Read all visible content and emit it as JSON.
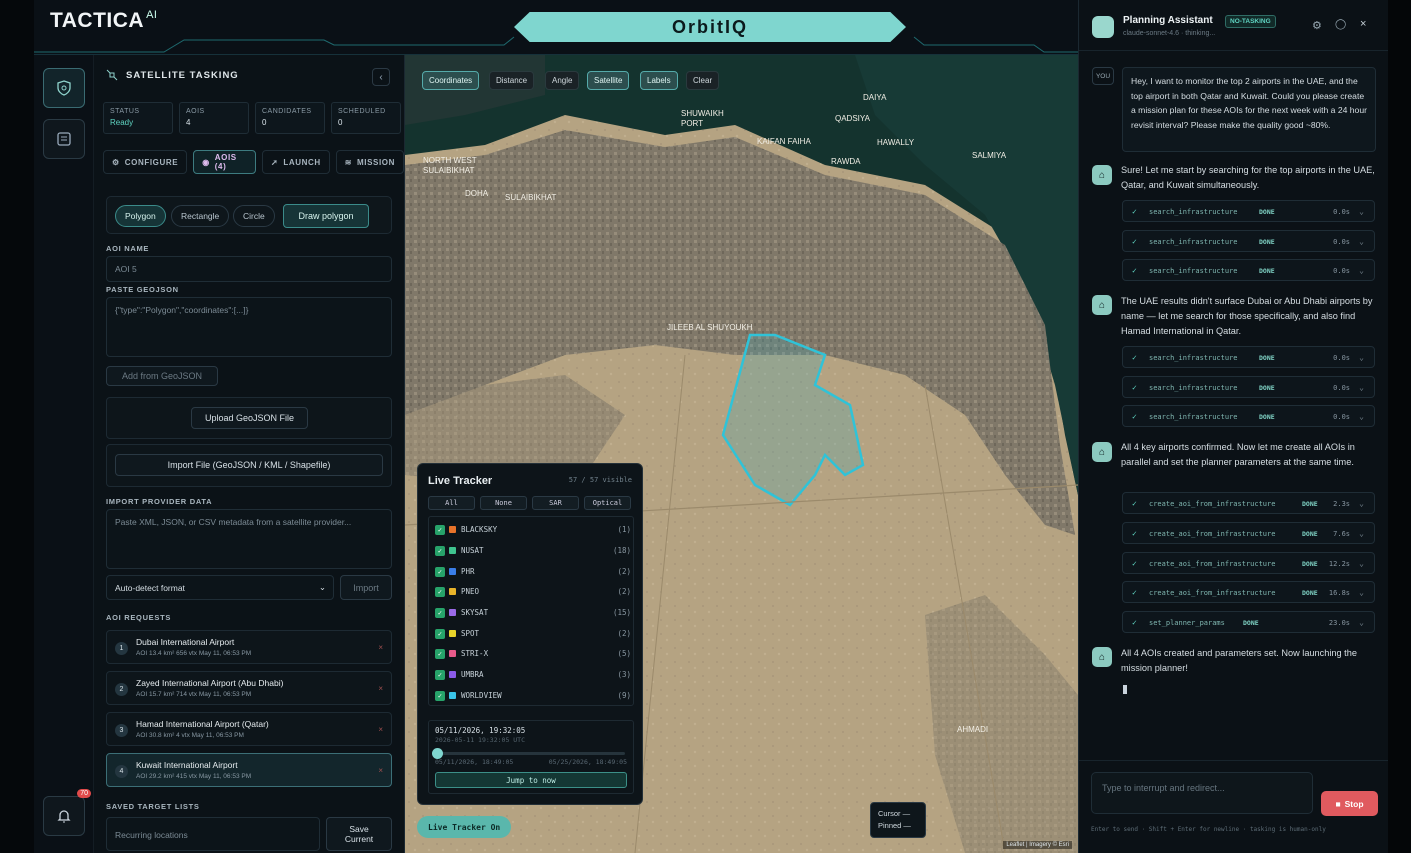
{
  "brand": {
    "name": "TACTICA",
    "suffix": "AI"
  },
  "center_title": "OrbitIQ",
  "panel": {
    "title": "SATELLITE TASKING",
    "stats": [
      {
        "k": "STATUS",
        "v": "Ready"
      },
      {
        "k": "AOIS",
        "v": "4"
      },
      {
        "k": "CANDIDATES",
        "v": "0"
      },
      {
        "k": "SCHEDULED",
        "v": "0"
      }
    ],
    "tabs": [
      "CONFIGURE",
      "AOIS (4)",
      "LAUNCH",
      "MISSION"
    ],
    "shapes": [
      "Polygon",
      "Rectangle",
      "Circle"
    ],
    "draw_polygon": "Draw polygon",
    "aoi_name_label": "AOI NAME",
    "aoi_name_value": "AOI 5",
    "geojson_label": "PASTE GEOJSON",
    "geojson_placeholder": "{\"type\":\"Polygon\",\"coordinates\":[...]}",
    "add_geojson": "Add from GeoJSON",
    "upload": "Upload GeoJSON File",
    "import_file": "Import File (GeoJSON / KML / Shapefile)",
    "provider_label": "IMPORT PROVIDER DATA",
    "provider_placeholder": "Paste XML, JSON, or CSV metadata from a satellite provider...",
    "format_select": "Auto-detect format",
    "import_btn": "Import",
    "requests_label": "AOI REQUESTS",
    "aois": [
      {
        "n": "1",
        "name": "Dubai International Airport",
        "meta": "AOI   13.4 km²    656 vtx    May 11, 06:53 PM"
      },
      {
        "n": "2",
        "name": "Zayed International Airport (Abu Dhabi)",
        "meta": "AOI   15.7 km²    714 vtx    May 11, 06:53 PM"
      },
      {
        "n": "3",
        "name": "Hamad International Airport (Qatar)",
        "meta": "AOI   30.8 km²    4 vtx    May 11, 06:53 PM"
      },
      {
        "n": "4",
        "name": "Kuwait International Airport",
        "meta": "AOI   29.2 km²    415 vtx    May 11, 06:53 PM"
      }
    ],
    "saved_label": "SAVED TARGET LISTS",
    "saved_placeholder": "Recurring locations",
    "save_current": "Save Current",
    "notif_count": "70"
  },
  "map": {
    "tools": [
      "Coordinates",
      "Distance",
      "Angle",
      "Satellite",
      "Labels",
      "Clear"
    ],
    "places": [
      "DAIYA",
      "SHUWAIKH PORT",
      "QADSIYA",
      "KAIFAN FAIHA",
      "HAWALLY",
      "SALMIYA",
      "NORTH WEST SULAIBIKHAT",
      "RAWDA",
      "DOHA",
      "SULAIBIKHAT",
      "JILEEB AL SHUYOUKH",
      "AHMADI"
    ],
    "tracker": {
      "title": "Live Tracker",
      "visible": "57 / 57 visible",
      "filters": [
        "All",
        "None",
        "SAR",
        "Optical"
      ],
      "providers": [
        {
          "name": "BLACKSKY",
          "count": "(1)",
          "color": "#e8732a"
        },
        {
          "name": "NUSAT",
          "count": "(18)",
          "color": "#3fc48f"
        },
        {
          "name": "PHR",
          "count": "(2)",
          "color": "#3a7ee8"
        },
        {
          "name": "PNEO",
          "count": "(2)",
          "color": "#e8b42a"
        },
        {
          "name": "SKYSAT",
          "count": "(15)",
          "color": "#9a6ae8"
        },
        {
          "name": "SPOT",
          "count": "(2)",
          "color": "#e8d42a"
        },
        {
          "name": "STRI-X",
          "count": "(5)",
          "color": "#e85a8a"
        },
        {
          "name": "UMBRA",
          "count": "(3)",
          "color": "#8a5ae8"
        },
        {
          "name": "WORLDVIEW",
          "count": "(9)",
          "color": "#3ac4e8"
        }
      ],
      "time_main": "05/11/2026, 19:32:05",
      "time_utc": "2026-05-11 19:32:05 UTC",
      "time_start": "05/11/2026, 18:49:05",
      "time_end": "05/25/2026, 18:49:05",
      "jump": "Jump to now"
    },
    "live_badge": "Live Tracker On",
    "cursor": "Cursor —",
    "pinned": "Pinned —"
  },
  "chat": {
    "title": "Planning Assistant",
    "badge": "NO-TASKING",
    "model": "claude-sonnet-4.6 · thinking...",
    "you": "YOU",
    "user_msg": "Hey, I want to monitor the top 2 airports in the UAE, and the top airport in both Qatar and Kuwait. Could you please create a mission plan for these AOIs for the next week with a 24 hour revisit interval? Please make the quality good ~80%.",
    "m1": "Sure! Let me start by searching for the top airports in the UAE, Qatar, and Kuwait simultaneously.",
    "m2": "The UAE results didn't surface Dubai or Abu Dhabi airports by name — let me search for those specifically, and also find Hamad International in Qatar.",
    "m3": "All 4 key airports confirmed. Now let me create all AOIs in parallel and set the planner parameters at the same time.",
    "m4": "All 4 AOIs created and parameters set. Now launching the mission planner!",
    "tools": [
      {
        "name": "search_infrastructure",
        "status": "DONE",
        "dur": "0.0s"
      },
      {
        "name": "search_infrastructure",
        "status": "DONE",
        "dur": "0.0s"
      },
      {
        "name": "search_infrastructure",
        "status": "DONE",
        "dur": "0.0s"
      },
      {
        "name": "search_infrastructure",
        "status": "DONE",
        "dur": "0.0s"
      },
      {
        "name": "search_infrastructure",
        "status": "DONE",
        "dur": "0.0s"
      },
      {
        "name": "search_infrastructure",
        "status": "DONE",
        "dur": "0.0s"
      },
      {
        "name": "create_aoi_from_infrastructure",
        "status": "DONE",
        "dur": "2.3s"
      },
      {
        "name": "create_aoi_from_infrastructure",
        "status": "DONE",
        "dur": "7.6s"
      },
      {
        "name": "create_aoi_from_infrastructure",
        "status": "DONE",
        "dur": "12.2s"
      },
      {
        "name": "create_aoi_from_infrastructure",
        "status": "DONE",
        "dur": "16.8s"
      },
      {
        "name": "set_planner_params",
        "status": "DONE",
        "dur": "23.0s"
      }
    ],
    "input_placeholder": "Type to interrupt and redirect...",
    "stop": "Stop",
    "hint": "Enter to send · Shift + Enter for newline · tasking is human-only",
    "attribution": "Leaflet | Imagery © Esri"
  }
}
